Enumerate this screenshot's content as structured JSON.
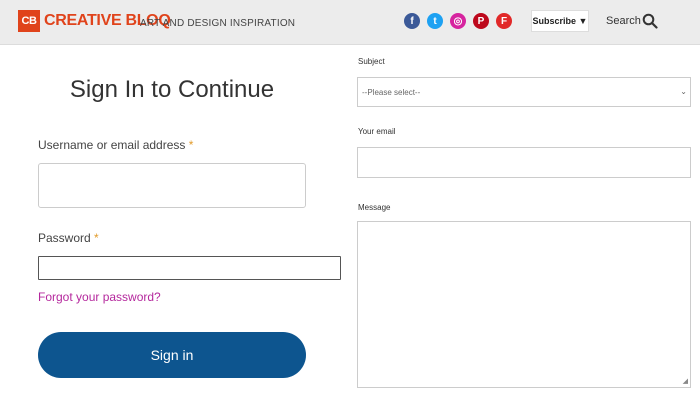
{
  "header": {
    "logo_mark": "CB",
    "logo_text": "CREATIVE BLOQ",
    "tagline": "ART AND DESIGN INSPIRATION",
    "social": [
      {
        "icon": "facebook-icon",
        "glyph": "f",
        "color": "#3b5998"
      },
      {
        "icon": "twitter-icon",
        "glyph": "t",
        "color": "#1da1f2"
      },
      {
        "icon": "instagram-icon",
        "glyph": "◎",
        "color": "#d6249f"
      },
      {
        "icon": "pinterest-icon",
        "glyph": "P",
        "color": "#bd081c"
      },
      {
        "icon": "flipboard-icon",
        "glyph": "F",
        "color": "#e12828"
      }
    ],
    "subscribe_label": "Subscribe ▼",
    "search_label": "Search"
  },
  "signin": {
    "title": "Sign In to Continue",
    "username_label": "Username or email address",
    "password_label": "Password",
    "required_mark": "*",
    "forgot_link": "Forgot your password?",
    "button_label": "Sign in"
  },
  "contact": {
    "subject_label": "Subject",
    "subject_selected": "--Please select--",
    "email_label": "Your email",
    "message_label": "Message"
  },
  "colors": {
    "brand": "#e0431b",
    "button": "#0d558f",
    "link": "#b5289d",
    "required": "#e29b2a"
  }
}
